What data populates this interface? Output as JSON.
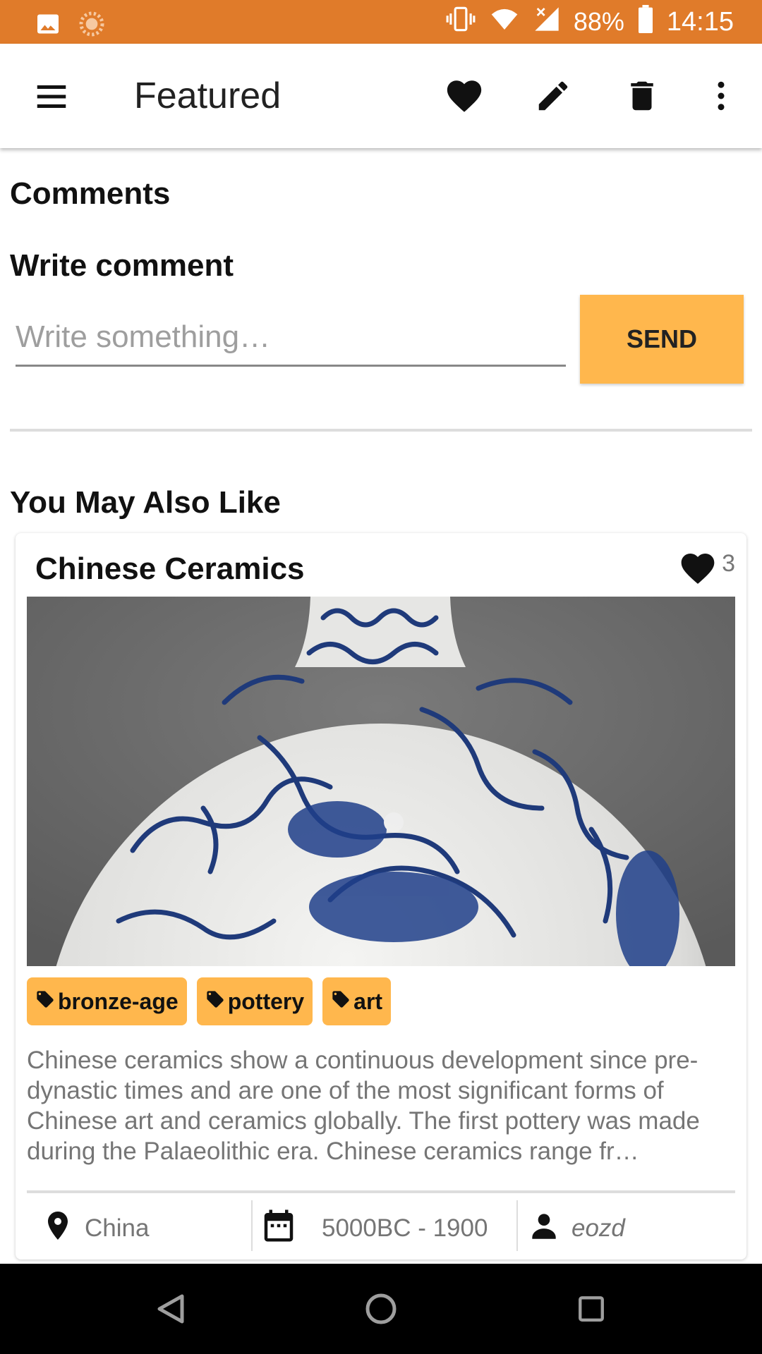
{
  "status_bar": {
    "battery_percent": "88%",
    "time": "14:15",
    "background_color": "#E07B2A",
    "icons": [
      "image-icon",
      "sync-icon",
      "vibrate-icon",
      "wifi-icon",
      "signal-icon",
      "battery-icon"
    ]
  },
  "app_bar": {
    "title": "Featured",
    "actions": [
      "heart-icon",
      "edit-icon",
      "delete-icon",
      "more-vert-icon"
    ]
  },
  "comments": {
    "heading": "Comments",
    "write_heading": "Write comment",
    "input_placeholder": "Write something…",
    "input_value": "",
    "send_label": "SEND"
  },
  "recommendations": {
    "heading": "You May Also Like",
    "card": {
      "title": "Chinese Ceramics",
      "likes": "3",
      "image_subject": "blue and white porcelain vase with dragon",
      "tags": [
        "bronze-age",
        "pottery",
        "art"
      ],
      "description": "Chinese ceramics show a continuous development since pre-dynastic times and are one of the most significant forms of Chinese art and ceramics globally. The first pottery was made during the Palaeolithic era. Chinese ceramics range fr…",
      "location": "China",
      "period": "5000BC - 1900",
      "author": "eozd"
    }
  },
  "colors": {
    "accent": "#FFB74D",
    "status": "#E07B2A"
  }
}
